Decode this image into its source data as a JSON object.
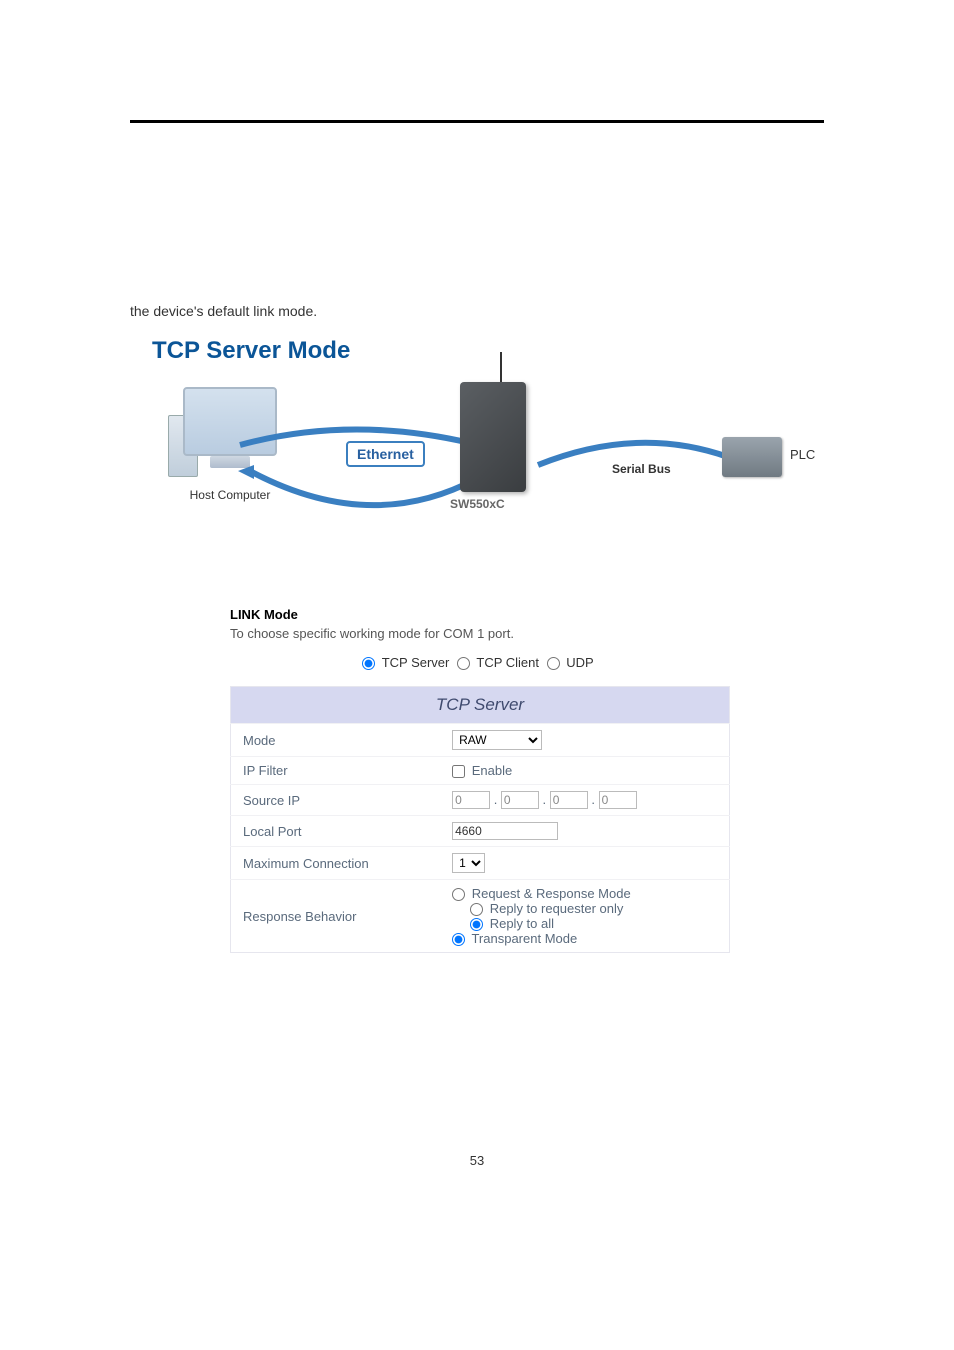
{
  "intro_text": "the device's default link mode.",
  "section_title": "TCP Server Mode",
  "diagram": {
    "host_label": "Host Computer",
    "ethernet_label": "Ethernet",
    "device_label": "SW550xC",
    "serial_label": "Serial Bus",
    "plc_label": "PLC"
  },
  "config": {
    "heading": "LINK Mode",
    "subtext": "To choose specific working mode for COM 1 port.",
    "radio_options": {
      "tcp_server": "TCP Server",
      "tcp_client": "TCP Client",
      "udp": "UDP"
    },
    "table_title": "TCP Server",
    "rows": {
      "mode_label": "Mode",
      "mode_value": "RAW",
      "ipfilter_label": "IP Filter",
      "ipfilter_checkbox": "Enable",
      "sourceip_label": "Source IP",
      "sourceip_octets": [
        "0",
        "0",
        "0",
        "0"
      ],
      "localport_label": "Local Port",
      "localport_value": "4660",
      "maxconn_label": "Maximum Connection",
      "maxconn_value": "1",
      "respbehavior_label": "Response Behavior",
      "resp_request": "Request & Response Mode",
      "resp_requester_only": "Reply to requester only",
      "resp_all": "Reply to all",
      "resp_transparent": "Transparent Mode"
    }
  },
  "page_number": "53"
}
